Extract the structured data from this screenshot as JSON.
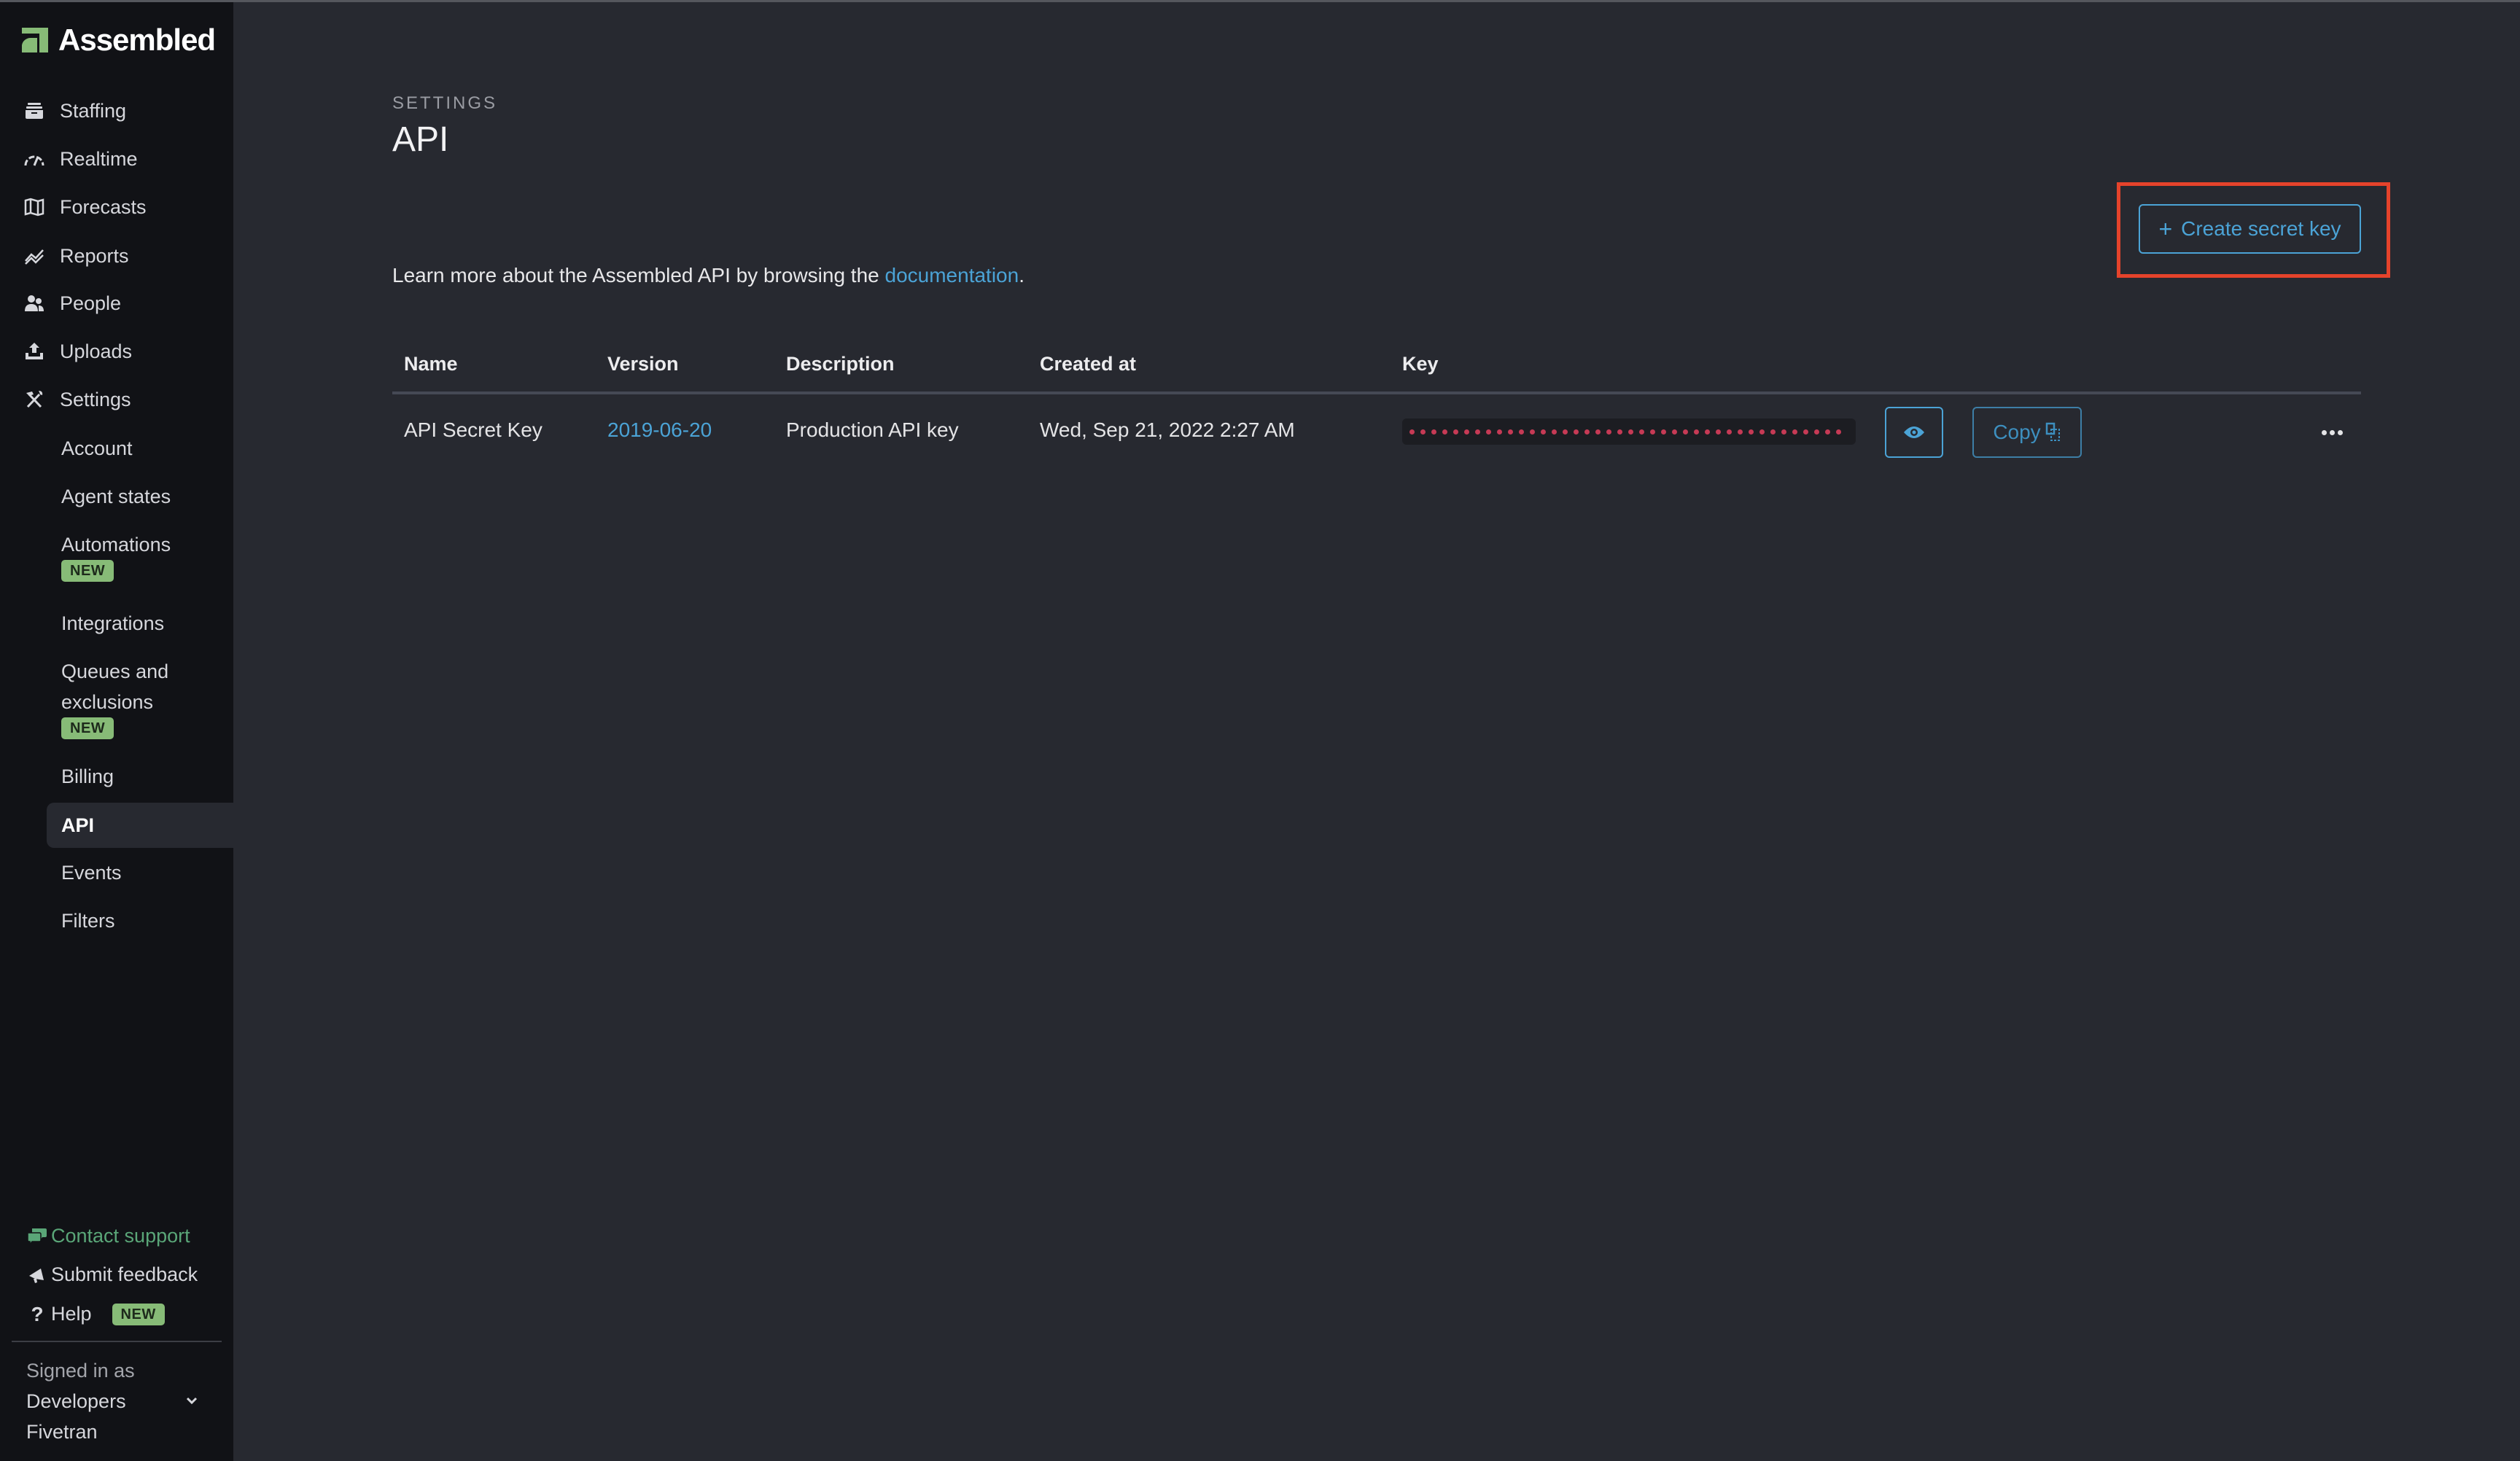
{
  "app": {
    "name": "Assembled"
  },
  "colors": {
    "accent_blue": "#4ba3d6",
    "brand_green": "#87bb77",
    "support_green": "#5aa678",
    "key_dot": "#c63a55",
    "highlight": "#e5432b"
  },
  "sidebar": {
    "nav": [
      {
        "label": "Staffing",
        "icon": "inbox-tray-icon"
      },
      {
        "label": "Realtime",
        "icon": "gauge-icon"
      },
      {
        "label": "Forecasts",
        "icon": "map-icon"
      },
      {
        "label": "Reports",
        "icon": "trend-chart-icon"
      },
      {
        "label": "People",
        "icon": "people-icon"
      },
      {
        "label": "Uploads",
        "icon": "upload-icon"
      },
      {
        "label": "Settings",
        "icon": "tools-icon"
      }
    ],
    "settings_items": [
      {
        "label": "Account"
      },
      {
        "label": "Agent states"
      },
      {
        "label": "Automations",
        "badge": "NEW"
      },
      {
        "label": "Integrations"
      },
      {
        "label": "Queues and exclusions",
        "badge": "NEW"
      },
      {
        "label": "Billing"
      },
      {
        "label": "API",
        "active": true
      },
      {
        "label": "Events"
      },
      {
        "label": "Filters"
      }
    ],
    "footer": {
      "contact_support": "Contact support",
      "submit_feedback": "Submit feedback",
      "help": "Help",
      "help_badge": "NEW",
      "signed_in_label": "Signed in as",
      "account_name_line1": "Developers",
      "account_name_line2": "Fivetran"
    }
  },
  "main": {
    "section_label": "SETTINGS",
    "title": "API",
    "intro_text": "Learn more about the Assembled API by browsing the ",
    "intro_link": "documentation",
    "intro_end": ".",
    "create_button": "Create secret key",
    "table": {
      "columns": [
        "Name",
        "Version",
        "Description",
        "Created at",
        "Key"
      ],
      "rows": [
        {
          "name": "API Secret Key",
          "version": "2019-06-20",
          "description": "Production API key",
          "created_at": "Wed, Sep 21, 2022 2:27 AM",
          "key_masked_length": 40,
          "copy_label": "Copy"
        }
      ]
    }
  }
}
